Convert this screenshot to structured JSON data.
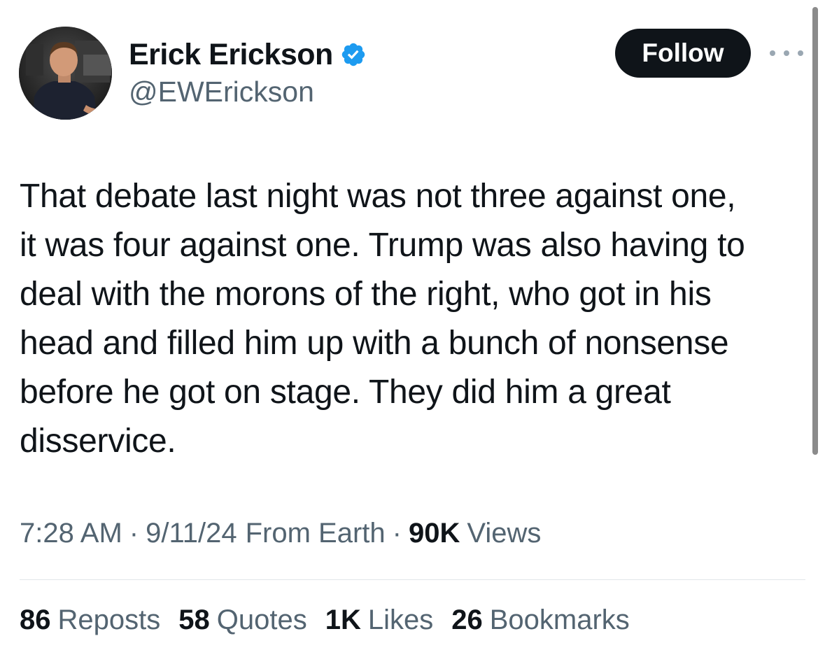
{
  "author": {
    "display_name": "Erick Erickson",
    "handle": "@EWErickson",
    "verified": true
  },
  "header": {
    "follow_label": "Follow",
    "more_icon": "more-horizontal-icon"
  },
  "tweet": {
    "text_lines": [
      "That debate last night was not three against one,",
      "it was four against one. Trump was also having to",
      "deal with the morons of the right, who got in his",
      "head and filled him up with a bunch of nonsense",
      "before he got on stage. They did him a great",
      "disservice."
    ]
  },
  "meta": {
    "time": "7:28 AM",
    "separator": "·",
    "date": "9/11/24",
    "source": "From Earth",
    "views_count": "90K",
    "views_label": "Views"
  },
  "stats": [
    {
      "count": "86",
      "label": "Reposts"
    },
    {
      "count": "58",
      "label": "Quotes"
    },
    {
      "count": "1K",
      "label": "Likes"
    },
    {
      "count": "26",
      "label": "Bookmarks"
    }
  ],
  "colors": {
    "text_primary": "#0f1419",
    "text_secondary": "#536471",
    "verified_blue": "#1d9bf0",
    "follow_bg": "#0f1419",
    "divider": "#e1e6ea"
  }
}
